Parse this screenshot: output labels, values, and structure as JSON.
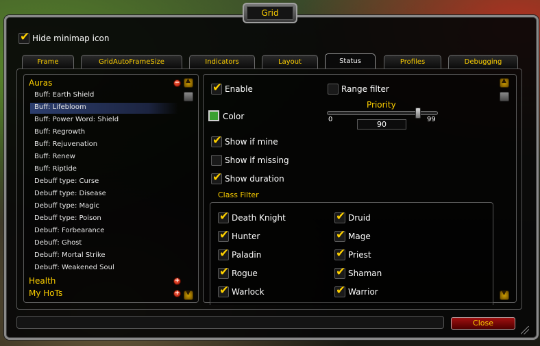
{
  "window": {
    "title": "Grid"
  },
  "top_option": {
    "label": "Hide minimap icon",
    "checked": true
  },
  "tabs": [
    {
      "label": "Frame",
      "active": false
    },
    {
      "label": "GridAutoFrameSize",
      "active": false
    },
    {
      "label": "Indicators",
      "active": false
    },
    {
      "label": "Layout",
      "active": false
    },
    {
      "label": "Status",
      "active": true
    },
    {
      "label": "Profiles",
      "active": false
    },
    {
      "label": "Debugging",
      "active": false
    }
  ],
  "tree": {
    "groups": {
      "auras": {
        "label": "Auras",
        "expanded": true
      },
      "health": {
        "label": "Health",
        "expanded": false
      },
      "hots": {
        "label": "My HoTs",
        "expanded": false
      }
    },
    "items": [
      "Buff: Earth Shield",
      "Buff: Lifebloom",
      "Buff: Power Word: Shield",
      "Buff: Regrowth",
      "Buff: Rejuvenation",
      "Buff: Renew",
      "Buff: Riptide",
      "Debuff type: Curse",
      "Debuff type: Disease",
      "Debuff type: Magic",
      "Debuff type: Poison",
      "Debuff: Forbearance",
      "Debuff: Ghost",
      "Debuff: Mortal Strike",
      "Debuff: Weakened Soul"
    ],
    "selected": "Buff: Lifebloom"
  },
  "options": {
    "enable": {
      "label": "Enable",
      "checked": true
    },
    "range_filter": {
      "label": "Range filter",
      "checked": false
    },
    "color": {
      "label": "Color",
      "value": "#3aa030"
    },
    "priority": {
      "label": "Priority",
      "min": "0",
      "max": "99",
      "value": "90"
    },
    "show_if_mine": {
      "label": "Show if mine",
      "checked": true
    },
    "show_if_missing": {
      "label": "Show if missing",
      "checked": false
    },
    "show_duration": {
      "label": "Show duration",
      "checked": true
    }
  },
  "class_filter": {
    "label": "Class Filter",
    "classes": [
      {
        "label": "Death Knight",
        "checked": true
      },
      {
        "label": "Druid",
        "checked": true
      },
      {
        "label": "Hunter",
        "checked": true
      },
      {
        "label": "Mage",
        "checked": true
      },
      {
        "label": "Paladin",
        "checked": true
      },
      {
        "label": "Priest",
        "checked": true
      },
      {
        "label": "Rogue",
        "checked": true
      },
      {
        "label": "Shaman",
        "checked": true
      },
      {
        "label": "Warlock",
        "checked": true
      },
      {
        "label": "Warrior",
        "checked": true
      }
    ]
  },
  "footer": {
    "close_label": "Close",
    "status_text": ""
  },
  "colors": {
    "accent": "#ffd100",
    "close_button": "#a01010",
    "selection": "#2c3e6e"
  }
}
